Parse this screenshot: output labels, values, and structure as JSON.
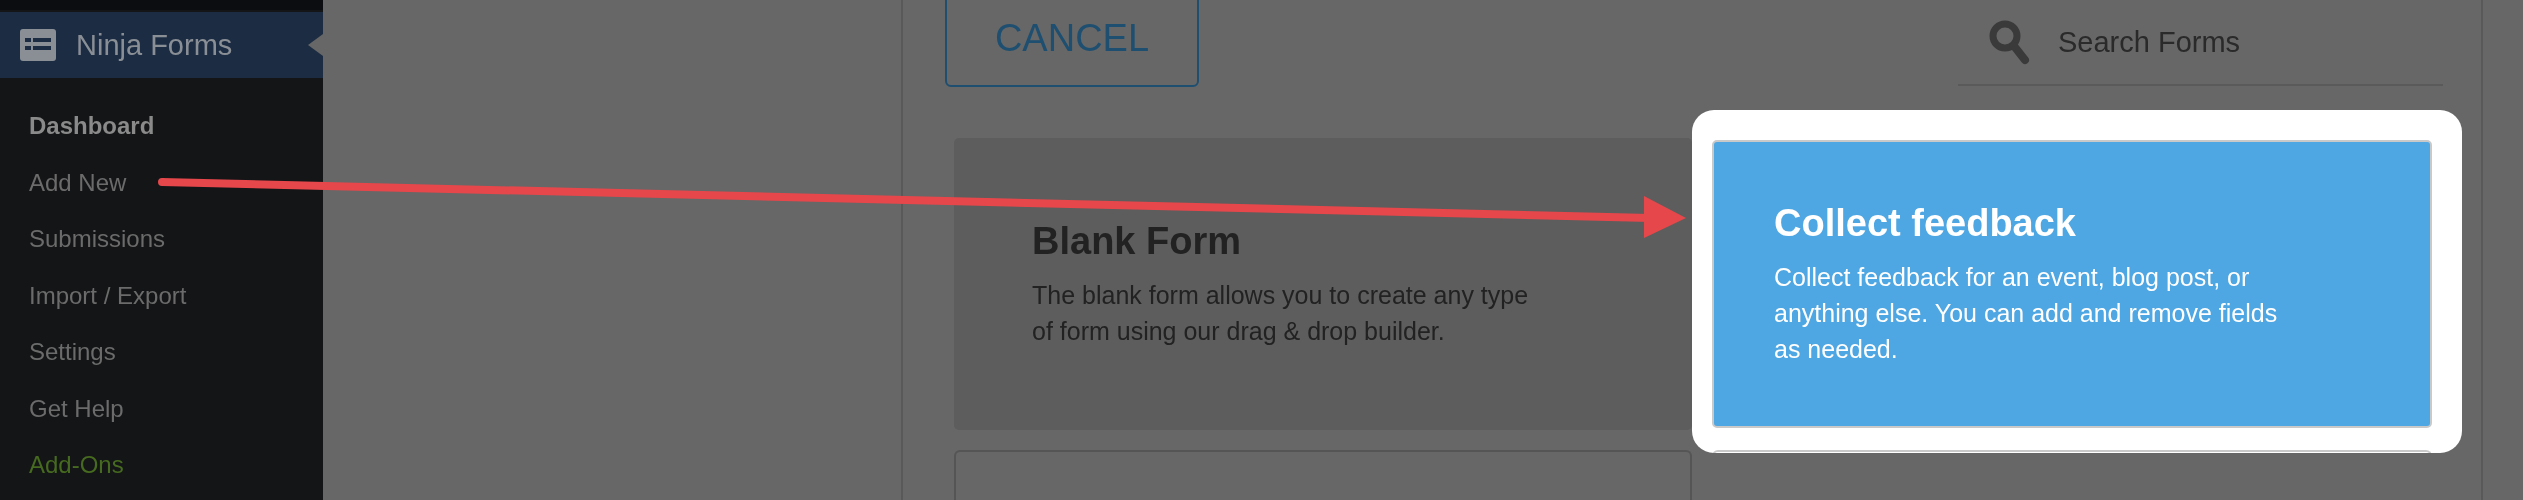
{
  "sidebar": {
    "header": {
      "title": "Ninja Forms",
      "selected": true
    },
    "items": [
      {
        "label": "Dashboard",
        "selected": true,
        "kind": "link"
      },
      {
        "label": "Add New",
        "selected": false,
        "kind": "link"
      },
      {
        "label": "Submissions",
        "selected": false,
        "kind": "link"
      },
      {
        "label": "Import / Export",
        "selected": false,
        "kind": "link"
      },
      {
        "label": "Settings",
        "selected": false,
        "kind": "link"
      },
      {
        "label": "Get Help",
        "selected": false,
        "kind": "link"
      },
      {
        "label": "Add-Ons",
        "selected": false,
        "kind": "addons"
      }
    ]
  },
  "cancel_button": "CANCEL",
  "search": {
    "placeholder": "Search Forms"
  },
  "templates": [
    {
      "title": "Blank Form",
      "description": "The blank form allows you to create any type of form using our drag & drop builder.",
      "selected": false
    },
    {
      "title": "Collect feedback",
      "description": "Collect feedback for an event, blog post, or anything else. You can add and remove fields as needed.",
      "selected": true
    }
  ]
}
